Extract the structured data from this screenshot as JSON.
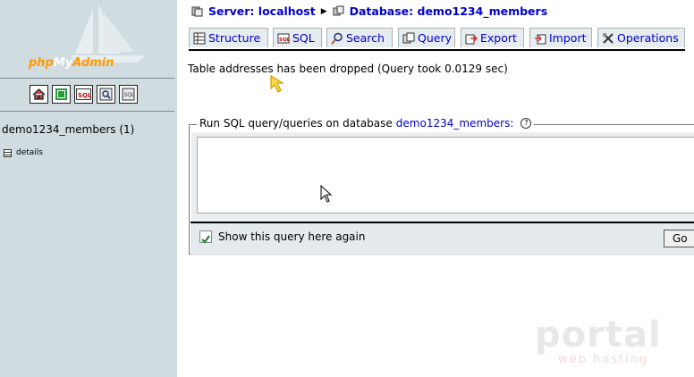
{
  "sidebar": {
    "logo": {
      "php": "php",
      "my": "My",
      "admin": "Admin"
    },
    "nav_icons": [
      "home-icon",
      "exit-icon",
      "sql-query-icon",
      "query-window-icon",
      "documentation-icon"
    ],
    "database": "demo1234_members (1)",
    "tables": [
      {
        "label": "details",
        "icon": "table-icon"
      }
    ]
  },
  "breadcrumb": {
    "server": "Server: localhost",
    "database": "Database: demo1234_members"
  },
  "tabs": [
    {
      "label": "Structure",
      "icon": "structure-icon"
    },
    {
      "label": "SQL",
      "icon": "sql-icon"
    },
    {
      "label": "Search",
      "icon": "search-icon"
    },
    {
      "label": "Query",
      "icon": "query-icon"
    },
    {
      "label": "Export",
      "icon": "export-icon"
    },
    {
      "label": "Import",
      "icon": "import-icon"
    },
    {
      "label": "Operations",
      "icon": "operations-icon"
    }
  ],
  "message": "Table addresses has been dropped (Query took 0.0129 sec)",
  "sql_panel": {
    "legend": "Run SQL query/queries on database",
    "database_link": "demo1234_members:",
    "help": "?",
    "query_text": "",
    "show_again_label": "Show this query here again",
    "show_again_checked": true,
    "go_label": "Go"
  },
  "watermark": {
    "title": "portal",
    "subtitle": "web hosting"
  },
  "colors": {
    "sidebar_bg": "#d0dce0",
    "link": "#0000cc",
    "logo_orange": "#ff9900",
    "tab_bg": "#e6ecef"
  }
}
